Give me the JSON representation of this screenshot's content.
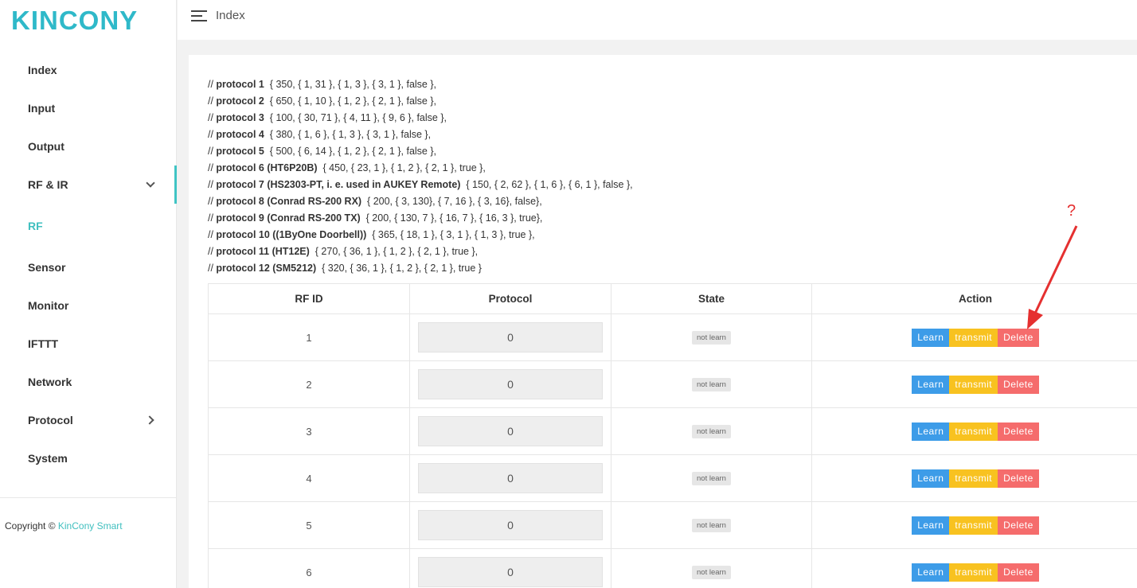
{
  "brand": {
    "logo_text": "KINCONY",
    "logo_color": "#2fb9c9"
  },
  "sidebar": {
    "items": [
      {
        "label": "Index"
      },
      {
        "label": "Input"
      },
      {
        "label": "Output"
      },
      {
        "label": "RF & IR"
      },
      {
        "label": "RF"
      },
      {
        "label": "Sensor"
      },
      {
        "label": "Monitor"
      },
      {
        "label": "IFTTT"
      },
      {
        "label": "Network"
      },
      {
        "label": "Protocol"
      },
      {
        "label": "System"
      }
    ],
    "copyright_prefix": "Copyright ©",
    "copyright_brand": "KinCony Smart"
  },
  "header": {
    "title": "Index"
  },
  "protocols": [
    {
      "name": "protocol 1",
      "value": "{ 350, { 1, 31 }, { 1, 3 }, { 3, 1 }, false },"
    },
    {
      "name": "protocol 2",
      "value": "{ 650, { 1, 10 }, { 1, 2 }, { 2, 1 }, false },"
    },
    {
      "name": "protocol 3",
      "value": "{ 100, { 30, 71 }, { 4, 11 }, { 9, 6 }, false },"
    },
    {
      "name": "protocol 4",
      "value": "{ 380, { 1, 6 }, { 1, 3 }, { 3, 1 }, false },"
    },
    {
      "name": "protocol 5",
      "value": "{ 500, { 6, 14 }, { 1, 2 }, { 2, 1 }, false },"
    },
    {
      "name": "protocol 6  (HT6P20B)",
      "value": "{ 450, { 23, 1 }, { 1, 2 }, { 2, 1 }, true },"
    },
    {
      "name": "protocol 7  (HS2303-PT, i. e. used in AUKEY Remote)",
      "value": "{ 150, { 2, 62 }, { 1, 6 }, { 6, 1 }, false },"
    },
    {
      "name": "protocol 8  (Conrad RS-200 RX)",
      "value": "{ 200, { 3, 130}, { 7, 16 }, { 3, 16}, false},"
    },
    {
      "name": "protocol 9  (Conrad RS-200 TX)",
      "value": "{ 200, { 130, 7 }, { 16, 7 }, { 16, 3 }, true},"
    },
    {
      "name": "protocol 10 ((1ByOne Doorbell))",
      "value": "{ 365, { 18, 1 }, { 3, 1 }, { 1, 3 }, true },"
    },
    {
      "name": "protocol 11 (HT12E)",
      "value": "{ 270, { 36, 1 }, { 1, 2 }, { 2, 1 }, true },"
    },
    {
      "name": "protocol 12 (SM5212)",
      "value": "{ 320, { 36, 1 }, { 1, 2 }, { 2, 1 }, true }"
    }
  ],
  "table": {
    "headers": [
      "RF ID",
      "Protocol",
      "State",
      "Action"
    ],
    "rows": [
      {
        "id": "1",
        "protocol": "0",
        "state": "not learn"
      },
      {
        "id": "2",
        "protocol": "0",
        "state": "not learn"
      },
      {
        "id": "3",
        "protocol": "0",
        "state": "not learn"
      },
      {
        "id": "4",
        "protocol": "0",
        "state": "not learn"
      },
      {
        "id": "5",
        "protocol": "0",
        "state": "not learn"
      },
      {
        "id": "6",
        "protocol": "0",
        "state": "not learn"
      }
    ],
    "actions": {
      "learn": "Learn",
      "transmit": "transmit",
      "delete": "Delete"
    }
  },
  "annotation": {
    "mark": "?",
    "color": "#e53030"
  }
}
